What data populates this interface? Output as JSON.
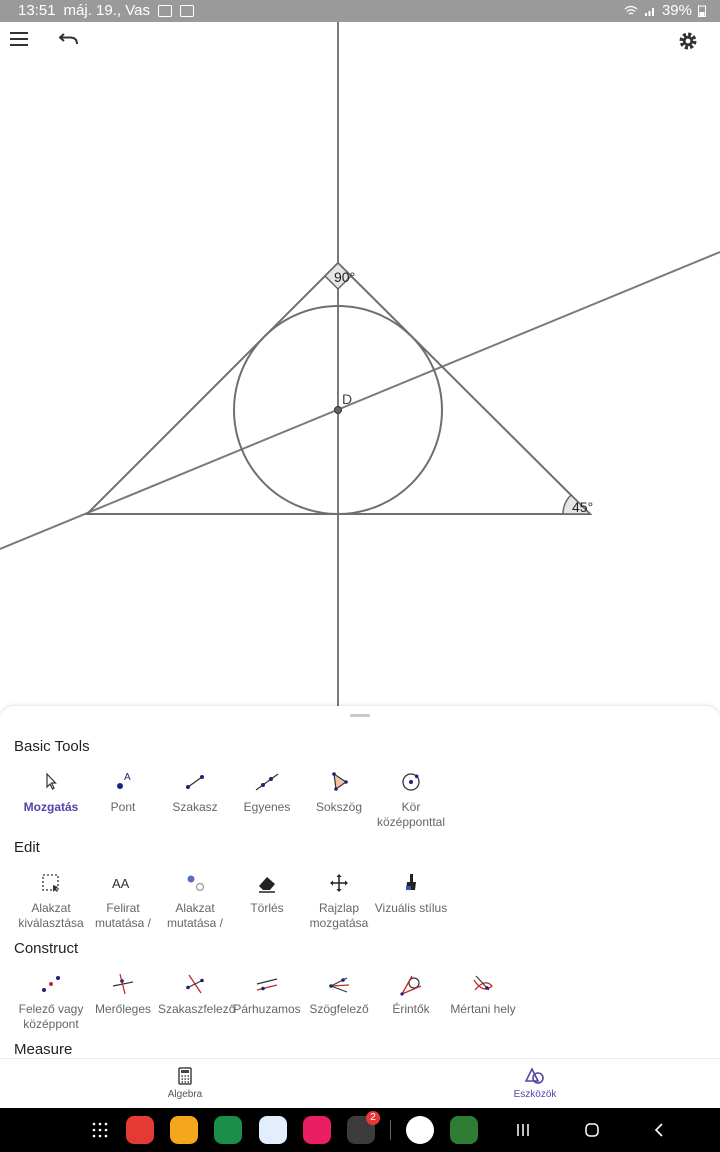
{
  "status": {
    "time": "13:51",
    "date": "máj. 19., Vas",
    "battery": "39%"
  },
  "canvas": {
    "labels": {
      "point_d": "D",
      "angle_top": "90°",
      "angle_right": "45°"
    }
  },
  "sheet": {
    "sections": {
      "basic": "Basic Tools",
      "edit": "Edit",
      "construct": "Construct",
      "measure": "Measure"
    },
    "basic_tools": [
      {
        "label": "Mozgatás",
        "icon": "arrow-pointer-icon"
      },
      {
        "label": "Pont",
        "icon": "point-icon"
      },
      {
        "label": "Szakasz",
        "icon": "segment-icon"
      },
      {
        "label": "Egyenes",
        "icon": "line-icon"
      },
      {
        "label": "Sokszög",
        "icon": "polygon-icon"
      },
      {
        "label": "Kör középponttal",
        "icon": "circle-center-icon"
      }
    ],
    "edit_tools": [
      {
        "label": "Alakzat kiválasztása",
        "icon": "select-icon"
      },
      {
        "label": "Felirat mutatása /",
        "icon": "caption-icon"
      },
      {
        "label": "Alakzat mutatása /",
        "icon": "show-object-icon"
      },
      {
        "label": "Törlés",
        "icon": "eraser-icon"
      },
      {
        "label": "Rajzlap mozgatása",
        "icon": "move-view-icon"
      },
      {
        "label": "Vizuális stílus",
        "icon": "brush-icon"
      }
    ],
    "construct_tools": [
      {
        "label": "Felező vagy középpont",
        "icon": "midpoint-icon"
      },
      {
        "label": "Merőleges",
        "icon": "perpendicular-icon"
      },
      {
        "label": "Szakaszfelező",
        "icon": "bisector-icon"
      },
      {
        "label": "Párhuzamos",
        "icon": "parallel-icon"
      },
      {
        "label": "Szögfelező",
        "icon": "angle-bisector-icon"
      },
      {
        "label": "Érintők",
        "icon": "tangent-icon"
      },
      {
        "label": "Mértani hely",
        "icon": "locus-icon"
      }
    ]
  },
  "nav": {
    "algebra": "Algebra",
    "tools": "Eszközök"
  },
  "badge": "2",
  "colors": {
    "accent": "#5145a8",
    "line": "#777777"
  }
}
